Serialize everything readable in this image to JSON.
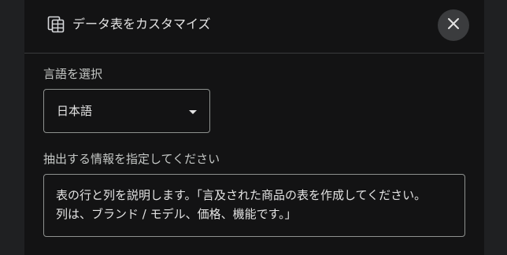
{
  "dialog": {
    "title": "データ表をカスタマイズ",
    "title_icon": "table-customize-icon",
    "close_icon": "close-icon"
  },
  "language": {
    "label": "言語を選択",
    "selected": "日本語",
    "caret_icon": "chevron-down-icon"
  },
  "extract": {
    "label": "抽出する情報を指定してください",
    "value": "表の行と列を説明します。「言及された商品の表を作成してください。\n列は、ブランド / モデル、価格、機能です。」"
  },
  "colors": {
    "background": "#131314",
    "border": "#8e918f",
    "text": "#e3e3e3",
    "close_button_bg": "#3b3c3e"
  }
}
